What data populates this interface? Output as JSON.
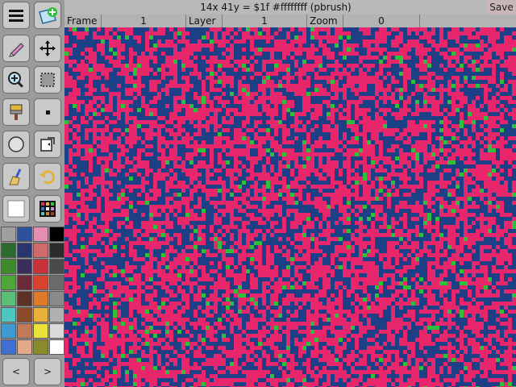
{
  "status": {
    "text": "14x  41y = $1f #ffffffff (pbrush)"
  },
  "save_label": "Save",
  "info": {
    "frame_label": "Frame",
    "frame_value": "1",
    "layer_label": "Layer",
    "layer_value": "1",
    "zoom_label": "Zoom",
    "zoom_value": "0"
  },
  "tools": [
    {
      "name": "menu-icon"
    },
    {
      "name": "new-layer-icon"
    },
    {
      "name": "pen-icon"
    },
    {
      "name": "move-icon"
    },
    {
      "name": "zoom-icon"
    },
    {
      "name": "selection-icon"
    },
    {
      "name": "paintbrush-icon"
    },
    {
      "name": "dot-icon"
    },
    {
      "name": "circle-icon"
    },
    {
      "name": "copy-icon"
    },
    {
      "name": "broom-icon"
    },
    {
      "name": "undo-icon"
    },
    {
      "name": "current-color-icon"
    },
    {
      "name": "palette-icon"
    }
  ],
  "palette": [
    "#9f9f9f",
    "#2f4f9a",
    "#e28fb3",
    "#000000",
    "#2c6b2f",
    "#2a3570",
    "#d16a6a",
    "#2b2b2b",
    "#3f8a2c",
    "#3a2f5a",
    "#c7323b",
    "#4a4a4a",
    "#4ea63a",
    "#6b2a3a",
    "#d9422f",
    "#6a6a6a",
    "#5bbf77",
    "#5a3326",
    "#e07a2b",
    "#8a8a8a",
    "#4fc7c0",
    "#8a4a2a",
    "#e8b23a",
    "#b0b0b0",
    "#3f9ad1",
    "#c07a5a",
    "#e8e23a",
    "#dadada",
    "#3f6fd1",
    "#e2a88a",
    "#8a8a2a",
    "#ffffff"
  ],
  "nav": {
    "prev": "<",
    "next": ">"
  },
  "colors": {
    "canvas_bg": "#1d3f86",
    "pink": "#e8266c",
    "green": "#2fbf3a"
  }
}
